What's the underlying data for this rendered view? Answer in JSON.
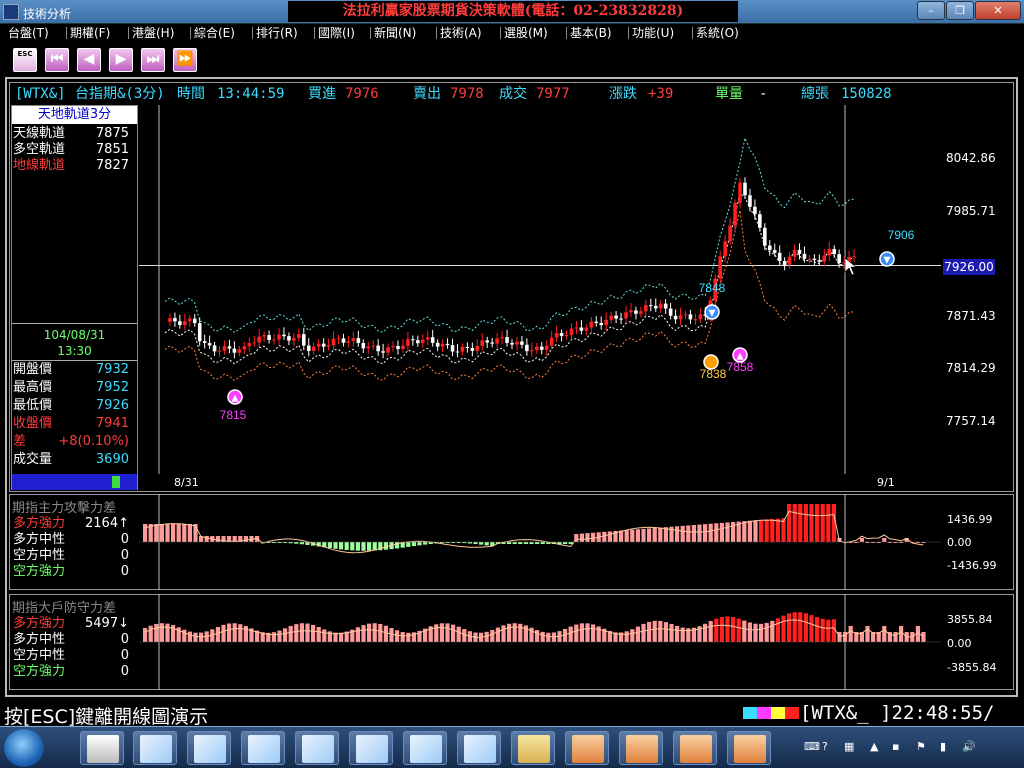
{
  "window": {
    "title": "技術分析",
    "banner": "法拉利贏家股票期貨決策軟體(電話：02-23832828)"
  },
  "menu": [
    "台盤(T)",
    "期權(F)",
    "港盤(H)",
    "綜合(E)",
    "排行(R)",
    "國際(I)",
    "新聞(N)",
    "技術(A)",
    "選股(M)",
    "基本(B)",
    "功能(U)",
    "系統(O)"
  ],
  "toolbar": {
    "esc_label": "ESC",
    "buttons": [
      "first-icon",
      "prev-icon",
      "next-icon",
      "last-icon",
      "forward-icon"
    ]
  },
  "quote": {
    "code": "[WTX&]",
    "name": "台指期&(3分)",
    "time_label": "時間",
    "time": "13:44:59",
    "buy_label": "買進",
    "buy": "7976",
    "sell_label": "賣出",
    "sell": "7978",
    "deal_label": "成交",
    "deal": "7977",
    "change_label": "漲跌",
    "change": "+39",
    "vol_label": "單量",
    "vol": "-",
    "total_label": "總張",
    "total": "150828"
  },
  "channel": {
    "header": "天地軌道3分",
    "rows": [
      {
        "label": "天線軌道",
        "value": "7875",
        "color": "#ffffff"
      },
      {
        "label": "多空軌道",
        "value": "7851",
        "color": "#ffffff"
      },
      {
        "label": "地線軌道",
        "value": "7827",
        "color": "#ff3c3c"
      }
    ]
  },
  "date_info": {
    "date": "104/08/31",
    "time": "13:30"
  },
  "ohlc": [
    {
      "label": "開盤價",
      "value": "7932",
      "lcolor": "#ffffff",
      "vcolor": "#3cdcff"
    },
    {
      "label": "最高價",
      "value": "7952",
      "lcolor": "#ffffff",
      "vcolor": "#3cdcff"
    },
    {
      "label": "最低價",
      "value": "7926",
      "lcolor": "#ffffff",
      "vcolor": "#3cdcff"
    },
    {
      "label": "收盤價",
      "value": "7941",
      "lcolor": "#ff3c3c",
      "vcolor": "#ff3c3c"
    },
    {
      "label": "差",
      "value": "+8(0.10%)",
      "lcolor": "#ff3c3c",
      "vcolor": "#ff3c3c"
    },
    {
      "label": "成交量",
      "value": "3690",
      "lcolor": "#ffffff",
      "vcolor": "#3cdcff"
    }
  ],
  "price_axis": [
    "8042.86",
    "7985.71",
    "7871.43",
    "7814.29",
    "7757.14"
  ],
  "current_price": "7926.00",
  "time_labels": [
    "8/31",
    "9/1"
  ],
  "markers": [
    "7815",
    "7838",
    "7858",
    "7848",
    "7906"
  ],
  "progress": 0.85,
  "indicator1": {
    "title": "期指主力攻擊力差",
    "rows": [
      {
        "label": "多方強力",
        "value": "2164↑",
        "color": "#ff3c3c"
      },
      {
        "label": "多方中性",
        "value": "0",
        "color": "#ffffff"
      },
      {
        "label": "空方中性",
        "value": "0",
        "color": "#ffffff"
      },
      {
        "label": "空方強力",
        "value": "0",
        "color": "#6cff6c"
      }
    ],
    "axis": [
      "1436.99",
      "0.00",
      "-1436.99"
    ]
  },
  "indicator2": {
    "title": "期指大戶防守力差",
    "rows": [
      {
        "label": "多方強力",
        "value": "5497↓",
        "color": "#ff3c3c"
      },
      {
        "label": "多方中性",
        "value": "0",
        "color": "#ffffff"
      },
      {
        "label": "空方中性",
        "value": "0",
        "color": "#ffffff"
      },
      {
        "label": "空方強力",
        "value": "0",
        "color": "#6cff6c"
      }
    ],
    "axis": [
      "3855.84",
      "0.00",
      "-3855.84"
    ]
  },
  "status": {
    "message": "按[ESC]鍵離開線圖演示",
    "right": "[WTX&_ ]22:48:55/"
  },
  "colors": {
    "up": "#ff2020",
    "down": "#ffffff",
    "band": "#66e0e0",
    "lower": "#ff8040"
  }
}
